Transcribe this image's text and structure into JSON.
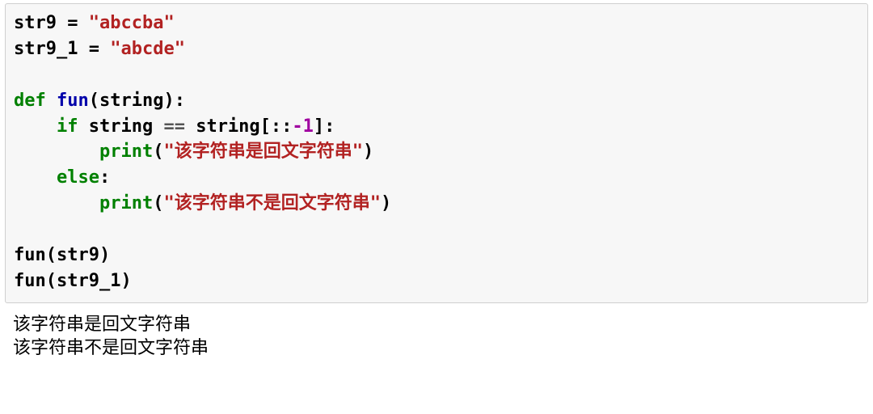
{
  "code": {
    "l1_var": "str9",
    "l1_eq": " = ",
    "l1_str": "\"abccba\"",
    "l2_var": "str9_1",
    "l2_eq": " = ",
    "l2_str": "\"abcde\"",
    "l4_def": "def",
    "l4_sp1": " ",
    "l4_fn": "fun",
    "l4_sig": "(string):",
    "l5_ind": "    ",
    "l5_if": "if",
    "l5_cond1": " string ",
    "l5_eqeq": "==",
    "l5_cond2": " string[::",
    "l5_neg1": "-1",
    "l5_cond3": "]:",
    "l6_ind": "        ",
    "l6_print": "print",
    "l6_open": "(",
    "l6_str": "\"该字符串是回文字符串\"",
    "l6_close": ")",
    "l7_ind": "    ",
    "l7_else": "else",
    "l7_colon": ":",
    "l8_ind": "        ",
    "l8_print": "print",
    "l8_open": "(",
    "l8_str": "\"该字符串不是回文字符串\"",
    "l8_close": ")",
    "l10": "fun(str9)",
    "l11": "fun(str9_1)"
  },
  "output": {
    "line1": "该字符串是回文字符串",
    "line2": "该字符串不是回文字符串"
  }
}
